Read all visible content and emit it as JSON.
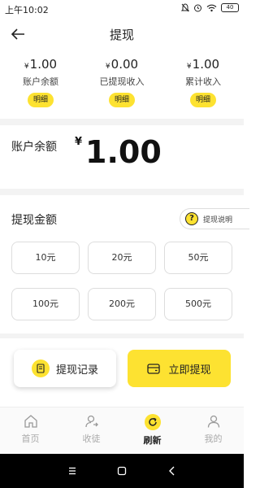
{
  "status": {
    "time": "上午10:02",
    "battery": "40"
  },
  "header": {
    "title": "提现"
  },
  "stats": [
    {
      "currency": "¥",
      "value": "1.00",
      "label": "账户余额",
      "button": "明细"
    },
    {
      "currency": "¥",
      "value": "0.00",
      "label": "已提现收入",
      "button": "明细"
    },
    {
      "currency": "¥",
      "value": "1.00",
      "label": "累计收入",
      "button": "明细"
    }
  ],
  "balance": {
    "label": "账户余额",
    "currency": "¥",
    "value": "1.00"
  },
  "withdraw": {
    "title": "提现金额",
    "info_label": "提现说明",
    "amounts": [
      "10元",
      "20元",
      "50元",
      "100元",
      "200元",
      "500元"
    ]
  },
  "actions": {
    "record_label": "提现记录",
    "withdraw_label": "立即提现"
  },
  "tabs": [
    {
      "label": "首页",
      "icon": "home-icon"
    },
    {
      "label": "收徒",
      "icon": "recruit-icon"
    },
    {
      "label": "刷新",
      "icon": "refresh-icon",
      "active": true
    },
    {
      "label": "我的",
      "icon": "profile-icon"
    }
  ],
  "colors": {
    "accent": "#fde231"
  }
}
